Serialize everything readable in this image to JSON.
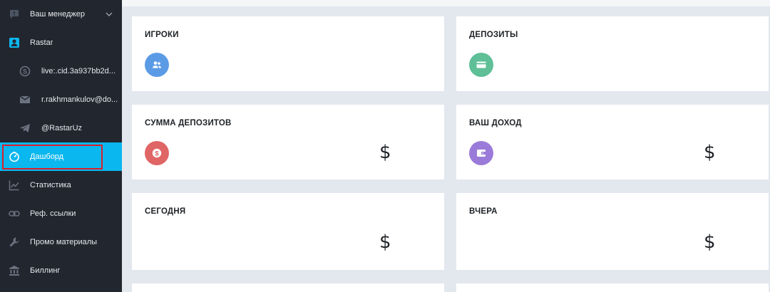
{
  "sidebar": {
    "manager": {
      "label": "Ваш менеджер",
      "icon": "chat-icon"
    },
    "contacts": [
      {
        "label": "Rastar",
        "icon": "contact-card-icon",
        "color": "#0bb7ef"
      },
      {
        "label": "live:.cid.3a937bb2d...",
        "icon": "skype-icon"
      },
      {
        "label": "r.rakhmankulov@do...",
        "icon": "mail-icon"
      },
      {
        "label": "@RastarUz",
        "icon": "telegram-icon"
      }
    ],
    "items": [
      {
        "label": "Дашборд",
        "icon": "dashboard-gauge-icon",
        "active": true
      },
      {
        "label": "Статистика",
        "icon": "line-chart-icon"
      },
      {
        "label": "Реф. ссылки",
        "icon": "link-icon"
      },
      {
        "label": "Промо материалы",
        "icon": "wrench-icon"
      },
      {
        "label": "Биллинг",
        "icon": "bank-icon"
      }
    ]
  },
  "cards": [
    {
      "title": "ИГРОКИ",
      "icon": "users-icon",
      "icon_color": "#5b9be6"
    },
    {
      "title": "ДЕПОЗИТЫ",
      "icon": "credit-card-icon",
      "icon_color": "#5fbf97"
    },
    {
      "title": "СУММА ДЕПОЗИТОВ",
      "icon": "dollar-coin-icon",
      "icon_color": "#e06565",
      "value": "$"
    },
    {
      "title": "ВАШ ДОХОД",
      "icon": "wallet-icon",
      "icon_color": "#9b7bd9",
      "value": "$"
    },
    {
      "title": "СЕГОДНЯ",
      "value": "$"
    },
    {
      "title": "ВЧЕРА",
      "value": "$"
    }
  ],
  "colors": {
    "sidebar_bg": "#22262f",
    "accent": "#0bb7ef",
    "highlight_outline": "#d9202a",
    "content_bg": "#e3e7ee"
  }
}
